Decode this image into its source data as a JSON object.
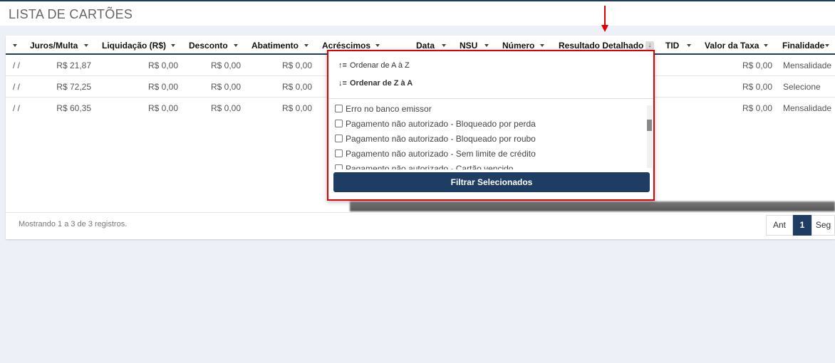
{
  "page": {
    "title": "LISTA DE CARTÕES"
  },
  "table": {
    "columns": [
      "Juros/Multa",
      "Liquidação (R$)",
      "Desconto",
      "Abatimento",
      "Acréscimos",
      "Data",
      "NSU",
      "Número",
      "Resultado Detalhado",
      "TID",
      "Valor da Taxa",
      "Finalidade"
    ],
    "rows": [
      {
        "first": "/ /",
        "juros": "R$ 21,87",
        "liquidacao": "R$ 0,00",
        "desconto": "R$ 0,00",
        "abatimento": "R$ 0,00",
        "taxa": "R$ 0,00",
        "finalidade": "Mensalidade"
      },
      {
        "first": "/ /",
        "juros": "R$ 72,25",
        "liquidacao": "R$ 0,00",
        "desconto": "R$ 0,00",
        "abatimento": "R$ 0,00",
        "taxa": "R$ 0,00",
        "finalidade": "Selecione"
      },
      {
        "first": "/ /",
        "juros": "R$ 60,35",
        "liquidacao": "R$ 0,00",
        "desconto": "R$ 0,00",
        "abatimento": "R$ 0,00",
        "taxa": "R$ 0,00",
        "finalidade": "Mensalidade"
      }
    ]
  },
  "footer": {
    "info": "Mostrando 1 a 3 de 3 registros."
  },
  "pagination": {
    "prev": "Ant",
    "current": "1",
    "next": "Seg"
  },
  "filter_popup": {
    "sort_asc": "Ordenar de A à Z",
    "sort_desc": "Ordenar de Z à A",
    "options": [
      "Erro no banco emissor",
      "Pagamento não autorizado - Bloqueado por perda",
      "Pagamento não autorizado - Bloqueado por roubo",
      "Pagamento não autorizado - Sem limite de crédito",
      "Pagamento não autorizado - Cartão vencido"
    ],
    "filter_button": "Filtrar Selecionados"
  },
  "colors": {
    "primary": "#1f3d63",
    "highlight": "#e00000"
  }
}
